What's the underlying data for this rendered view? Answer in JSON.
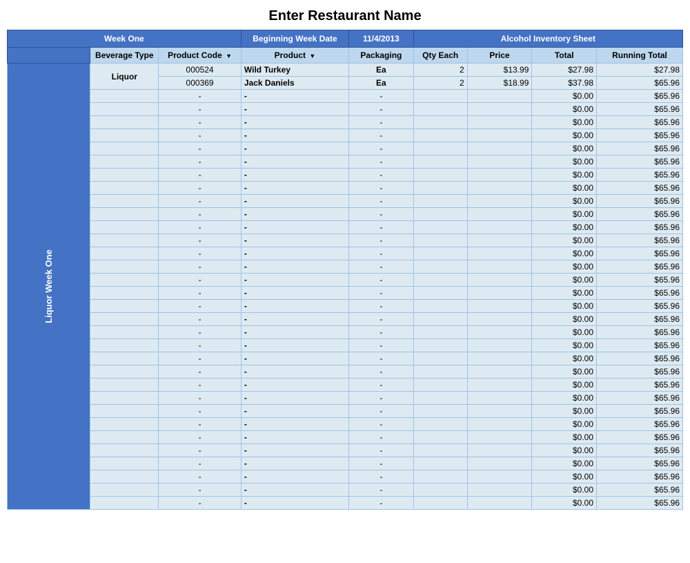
{
  "title": "Enter Restaurant Name",
  "header1": {
    "week_one": "Week One",
    "begin_week_date_label": "Beginning Week Date",
    "begin_week_date_value": "11/4/2013",
    "alcohol_inventory": "Alcohol Inventory Sheet"
  },
  "header2": {
    "beverage_type": "Beverage Type",
    "product_code": "Product Code",
    "product": "Product",
    "packaging": "Packaging",
    "qty_each": "Qty Each",
    "price": "Price",
    "total": "Total",
    "running_total": "Running Total"
  },
  "side_label": "Liquor Week One",
  "rows": [
    {
      "bev_type": "Liquor",
      "code": "000524",
      "product": "Wild Turkey",
      "packaging": "Ea",
      "qty": "2",
      "price": "$13.99",
      "total": "$27.98",
      "running": "$27.98"
    },
    {
      "bev_type": "",
      "code": "000369",
      "product": "Jack Daniels",
      "packaging": "Ea",
      "qty": "2",
      "price": "$18.99",
      "total": "$37.98",
      "running": "$65.96"
    },
    {
      "bev_type": "",
      "code": "-",
      "product": "-",
      "packaging": "-",
      "qty": "",
      "price": "",
      "total": "$0.00",
      "running": "$65.96"
    },
    {
      "bev_type": "",
      "code": "-",
      "product": "-",
      "packaging": "-",
      "qty": "",
      "price": "",
      "total": "$0.00",
      "running": "$65.96"
    },
    {
      "bev_type": "",
      "code": "-",
      "product": "-",
      "packaging": "-",
      "qty": "",
      "price": "",
      "total": "$0.00",
      "running": "$65.96"
    },
    {
      "bev_type": "",
      "code": "-",
      "product": "-",
      "packaging": "-",
      "qty": "",
      "price": "",
      "total": "$0.00",
      "running": "$65.96"
    },
    {
      "bev_type": "",
      "code": "-",
      "product": "-",
      "packaging": "-",
      "qty": "",
      "price": "",
      "total": "$0.00",
      "running": "$65.96"
    },
    {
      "bev_type": "",
      "code": "-",
      "product": "-",
      "packaging": "-",
      "qty": "",
      "price": "",
      "total": "$0.00",
      "running": "$65.96"
    },
    {
      "bev_type": "",
      "code": "-",
      "product": "-",
      "packaging": "-",
      "qty": "",
      "price": "",
      "total": "$0.00",
      "running": "$65.96"
    },
    {
      "bev_type": "",
      "code": "-",
      "product": "-",
      "packaging": "-",
      "qty": "",
      "price": "",
      "total": "$0.00",
      "running": "$65.96"
    },
    {
      "bev_type": "",
      "code": "-",
      "product": "-",
      "packaging": "-",
      "qty": "",
      "price": "",
      "total": "$0.00",
      "running": "$65.96"
    },
    {
      "bev_type": "",
      "code": "-",
      "product": "-",
      "packaging": "-",
      "qty": "",
      "price": "",
      "total": "$0.00",
      "running": "$65.96"
    },
    {
      "bev_type": "",
      "code": "-",
      "product": "-",
      "packaging": "-",
      "qty": "",
      "price": "",
      "total": "$0.00",
      "running": "$65.96"
    },
    {
      "bev_type": "",
      "code": "-",
      "product": "-",
      "packaging": "-",
      "qty": "",
      "price": "",
      "total": "$0.00",
      "running": "$65.96"
    },
    {
      "bev_type": "",
      "code": "-",
      "product": "-",
      "packaging": "-",
      "qty": "",
      "price": "",
      "total": "$0.00",
      "running": "$65.96"
    },
    {
      "bev_type": "",
      "code": "-",
      "product": "-",
      "packaging": "-",
      "qty": "",
      "price": "",
      "total": "$0.00",
      "running": "$65.96"
    },
    {
      "bev_type": "",
      "code": "-",
      "product": "-",
      "packaging": "-",
      "qty": "",
      "price": "",
      "total": "$0.00",
      "running": "$65.96"
    },
    {
      "bev_type": "",
      "code": "-",
      "product": "-",
      "packaging": "-",
      "qty": "",
      "price": "",
      "total": "$0.00",
      "running": "$65.96"
    },
    {
      "bev_type": "",
      "code": "-",
      "product": "-",
      "packaging": "-",
      "qty": "",
      "price": "",
      "total": "$0.00",
      "running": "$65.96"
    },
    {
      "bev_type": "",
      "code": "-",
      "product": "-",
      "packaging": "-",
      "qty": "",
      "price": "",
      "total": "$0.00",
      "running": "$65.96"
    },
    {
      "bev_type": "",
      "code": "-",
      "product": "-",
      "packaging": "-",
      "qty": "",
      "price": "",
      "total": "$0.00",
      "running": "$65.96"
    },
    {
      "bev_type": "",
      "code": "-",
      "product": "-",
      "packaging": "-",
      "qty": "",
      "price": "",
      "total": "$0.00",
      "running": "$65.96"
    },
    {
      "bev_type": "",
      "code": "-",
      "product": "-",
      "packaging": "-",
      "qty": "",
      "price": "",
      "total": "$0.00",
      "running": "$65.96"
    },
    {
      "bev_type": "",
      "code": "-",
      "product": "-",
      "packaging": "-",
      "qty": "",
      "price": "",
      "total": "$0.00",
      "running": "$65.96"
    },
    {
      "bev_type": "",
      "code": "-",
      "product": "-",
      "packaging": "-",
      "qty": "",
      "price": "",
      "total": "$0.00",
      "running": "$65.96"
    },
    {
      "bev_type": "",
      "code": "-",
      "product": "-",
      "packaging": "-",
      "qty": "",
      "price": "",
      "total": "$0.00",
      "running": "$65.96"
    },
    {
      "bev_type": "",
      "code": "-",
      "product": "-",
      "packaging": "-",
      "qty": "",
      "price": "",
      "total": "$0.00",
      "running": "$65.96"
    },
    {
      "bev_type": "",
      "code": "-",
      "product": "-",
      "packaging": "-",
      "qty": "",
      "price": "",
      "total": "$0.00",
      "running": "$65.96"
    },
    {
      "bev_type": "",
      "code": "-",
      "product": "-",
      "packaging": "-",
      "qty": "",
      "price": "",
      "total": "$0.00",
      "running": "$65.96"
    },
    {
      "bev_type": "",
      "code": "-",
      "product": "-",
      "packaging": "-",
      "qty": "",
      "price": "",
      "total": "$0.00",
      "running": "$65.96"
    },
    {
      "bev_type": "",
      "code": "-",
      "product": "-",
      "packaging": "-",
      "qty": "",
      "price": "",
      "total": "$0.00",
      "running": "$65.96"
    },
    {
      "bev_type": "",
      "code": "-",
      "product": "-",
      "packaging": "-",
      "qty": "",
      "price": "",
      "total": "$0.00",
      "running": "$65.96"
    },
    {
      "bev_type": "",
      "code": "-",
      "product": "-",
      "packaging": "-",
      "qty": "",
      "price": "",
      "total": "$0.00",
      "running": "$65.96"
    },
    {
      "bev_type": "",
      "code": "-",
      "product": "-",
      "packaging": "-",
      "qty": "",
      "price": "",
      "total": "$0.00",
      "running": "$65.96"
    }
  ]
}
